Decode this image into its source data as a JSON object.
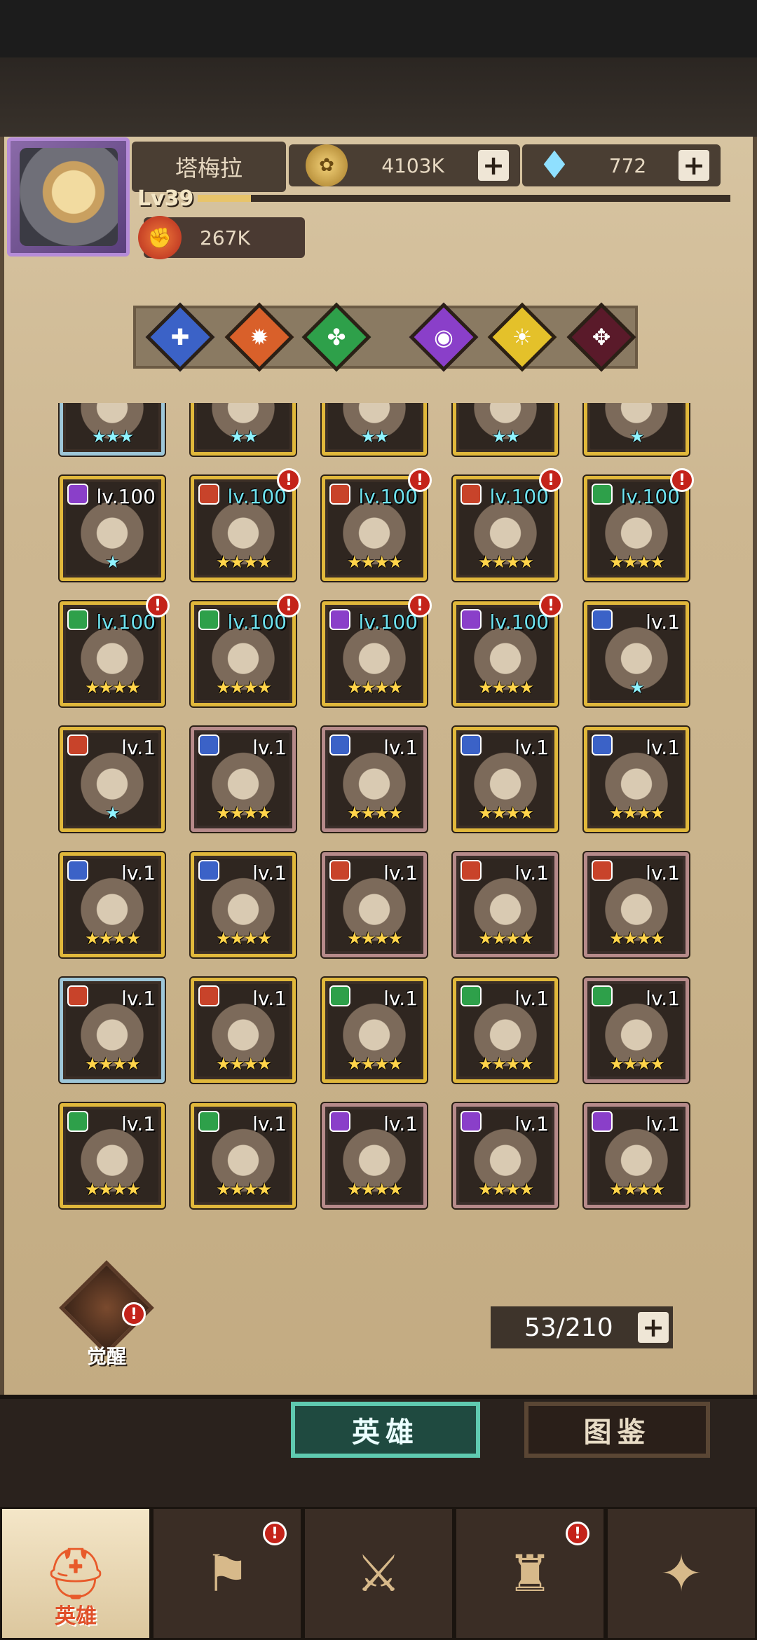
{
  "header": {
    "player_name": "塔梅拉",
    "level": "Lv39",
    "xp_fraction": 0.1,
    "power": "267K",
    "gold": "4103K",
    "gems": "772"
  },
  "filters": [
    {
      "name": "holy",
      "color": "#3b62c7",
      "glyph": "✚"
    },
    {
      "name": "fire",
      "color": "#d9602a",
      "glyph": "✹"
    },
    {
      "name": "nature",
      "color": "#2ea04a",
      "glyph": "✤"
    },
    {
      "name": "arcane",
      "color": "#8a3fc9",
      "glyph": "◉"
    },
    {
      "name": "light",
      "color": "#e4c12a",
      "glyph": "☀"
    },
    {
      "name": "dark",
      "color": "#5a1a2a",
      "glyph": "✥"
    }
  ],
  "heroes": [
    {
      "lvl": "",
      "stars": "★★★",
      "star_color": "cyan",
      "frame": "blue",
      "elem": "#9ec7d9",
      "alert": false
    },
    {
      "lvl": "",
      "stars": "★★",
      "star_color": "cyan",
      "frame": "gold",
      "elem": "#9ec7d9",
      "alert": false
    },
    {
      "lvl": "",
      "stars": "★★",
      "star_color": "cyan",
      "frame": "gold",
      "elem": "#9ec7d9",
      "alert": false
    },
    {
      "lvl": "",
      "stars": "★★",
      "star_color": "cyan",
      "frame": "gold",
      "elem": "#9ec7d9",
      "alert": false
    },
    {
      "lvl": "",
      "stars": "★",
      "star_color": "cyan",
      "frame": "gold",
      "elem": "#9ec7d9",
      "alert": false
    },
    {
      "lvl": "lv.100",
      "lvl_color": "white",
      "stars": "★",
      "star_color": "cyan",
      "frame": "gold",
      "elem": "#8a3fc9",
      "alert": false
    },
    {
      "lvl": "lv.100",
      "lvl_color": "cyan",
      "stars": "★★★★",
      "star_color": "gold",
      "frame": "gold",
      "elem": "#c8432a",
      "alert": true
    },
    {
      "lvl": "lv.100",
      "lvl_color": "cyan",
      "stars": "★★★★",
      "star_color": "gold",
      "frame": "gold",
      "elem": "#c8432a",
      "alert": true
    },
    {
      "lvl": "lv.100",
      "lvl_color": "cyan",
      "stars": "★★★★",
      "star_color": "gold",
      "frame": "gold",
      "elem": "#c8432a",
      "alert": true
    },
    {
      "lvl": "lv.100",
      "lvl_color": "cyan",
      "stars": "★★★★",
      "star_color": "gold",
      "frame": "gold",
      "elem": "#2ea04a",
      "alert": true
    },
    {
      "lvl": "lv.100",
      "lvl_color": "cyan",
      "stars": "★★★★",
      "star_color": "gold",
      "frame": "gold",
      "elem": "#2ea04a",
      "alert": true
    },
    {
      "lvl": "lv.100",
      "lvl_color": "cyan",
      "stars": "★★★★",
      "star_color": "gold",
      "frame": "gold",
      "elem": "#2ea04a",
      "alert": true
    },
    {
      "lvl": "lv.100",
      "lvl_color": "cyan",
      "stars": "★★★★",
      "star_color": "gold",
      "frame": "gold",
      "elem": "#8a3fc9",
      "alert": true
    },
    {
      "lvl": "lv.100",
      "lvl_color": "cyan",
      "stars": "★★★★",
      "star_color": "gold",
      "frame": "gold",
      "elem": "#8a3fc9",
      "alert": true
    },
    {
      "lvl": "lv.1",
      "lvl_color": "white",
      "stars": "★",
      "star_color": "cyan",
      "frame": "gold",
      "elem": "#3b62c7",
      "alert": false
    },
    {
      "lvl": "lv.1",
      "lvl_color": "white",
      "stars": "★",
      "star_color": "cyan",
      "frame": "gold",
      "elem": "#c8432a",
      "alert": false
    },
    {
      "lvl": "lv.1",
      "lvl_color": "white",
      "stars": "★★★★",
      "star_color": "gold",
      "frame": "purple",
      "elem": "#3b62c7",
      "alert": false
    },
    {
      "lvl": "lv.1",
      "lvl_color": "white",
      "stars": "★★★★",
      "star_color": "gold",
      "frame": "purple",
      "elem": "#3b62c7",
      "alert": false
    },
    {
      "lvl": "lv.1",
      "lvl_color": "white",
      "stars": "★★★★",
      "star_color": "gold",
      "frame": "gold",
      "elem": "#3b62c7",
      "alert": false
    },
    {
      "lvl": "lv.1",
      "lvl_color": "white",
      "stars": "★★★★",
      "star_color": "gold",
      "frame": "gold",
      "elem": "#3b62c7",
      "alert": false
    },
    {
      "lvl": "lv.1",
      "lvl_color": "white",
      "stars": "★★★★",
      "star_color": "gold",
      "frame": "gold",
      "elem": "#3b62c7",
      "alert": false
    },
    {
      "lvl": "lv.1",
      "lvl_color": "white",
      "stars": "★★★★",
      "star_color": "gold",
      "frame": "gold",
      "elem": "#3b62c7",
      "alert": false
    },
    {
      "lvl": "lv.1",
      "lvl_color": "white",
      "stars": "★★★★",
      "star_color": "gold",
      "frame": "purple",
      "elem": "#c8432a",
      "alert": false
    },
    {
      "lvl": "lv.1",
      "lvl_color": "white",
      "stars": "★★★★",
      "star_color": "gold",
      "frame": "purple",
      "elem": "#c8432a",
      "alert": false
    },
    {
      "lvl": "lv.1",
      "lvl_color": "white",
      "stars": "★★★★",
      "star_color": "gold",
      "frame": "purple",
      "elem": "#c8432a",
      "alert": false
    },
    {
      "lvl": "lv.1",
      "lvl_color": "white",
      "stars": "★★★★",
      "star_color": "gold",
      "frame": "blue",
      "elem": "#c8432a",
      "alert": false
    },
    {
      "lvl": "lv.1",
      "lvl_color": "white",
      "stars": "★★★★",
      "star_color": "gold",
      "frame": "gold",
      "elem": "#c8432a",
      "alert": false
    },
    {
      "lvl": "lv.1",
      "lvl_color": "white",
      "stars": "★★★★",
      "star_color": "gold",
      "frame": "gold",
      "elem": "#2ea04a",
      "alert": false
    },
    {
      "lvl": "lv.1",
      "lvl_color": "white",
      "stars": "★★★★",
      "star_color": "gold",
      "frame": "gold",
      "elem": "#2ea04a",
      "alert": false
    },
    {
      "lvl": "lv.1",
      "lvl_color": "white",
      "stars": "★★★★",
      "star_color": "gold",
      "frame": "purple",
      "elem": "#2ea04a",
      "alert": false
    },
    {
      "lvl": "lv.1",
      "lvl_color": "white",
      "stars": "★★★★",
      "star_color": "gold",
      "frame": "gold",
      "elem": "#2ea04a",
      "alert": false
    },
    {
      "lvl": "lv.1",
      "lvl_color": "white",
      "stars": "★★★★",
      "star_color": "gold",
      "frame": "gold",
      "elem": "#2ea04a",
      "alert": false
    },
    {
      "lvl": "lv.1",
      "lvl_color": "white",
      "stars": "★★★★",
      "star_color": "gold",
      "frame": "purple",
      "elem": "#8a3fc9",
      "alert": false
    },
    {
      "lvl": "lv.1",
      "lvl_color": "white",
      "stars": "★★★★",
      "star_color": "gold",
      "frame": "purple",
      "elem": "#8a3fc9",
      "alert": false
    },
    {
      "lvl": "lv.1",
      "lvl_color": "white",
      "stars": "★★★★",
      "star_color": "gold",
      "frame": "purple",
      "elem": "#8a3fc9",
      "alert": false
    }
  ],
  "awaken_label": "觉醒",
  "capacity": "53/210",
  "tabs": {
    "heroes": "英雄",
    "codex": "图鉴"
  },
  "nav": {
    "heroes_label": "英雄"
  },
  "colors": {
    "accent": "#e85a2a",
    "gold_frame": "#e1b83b",
    "tab_active": "#5fcab0"
  }
}
